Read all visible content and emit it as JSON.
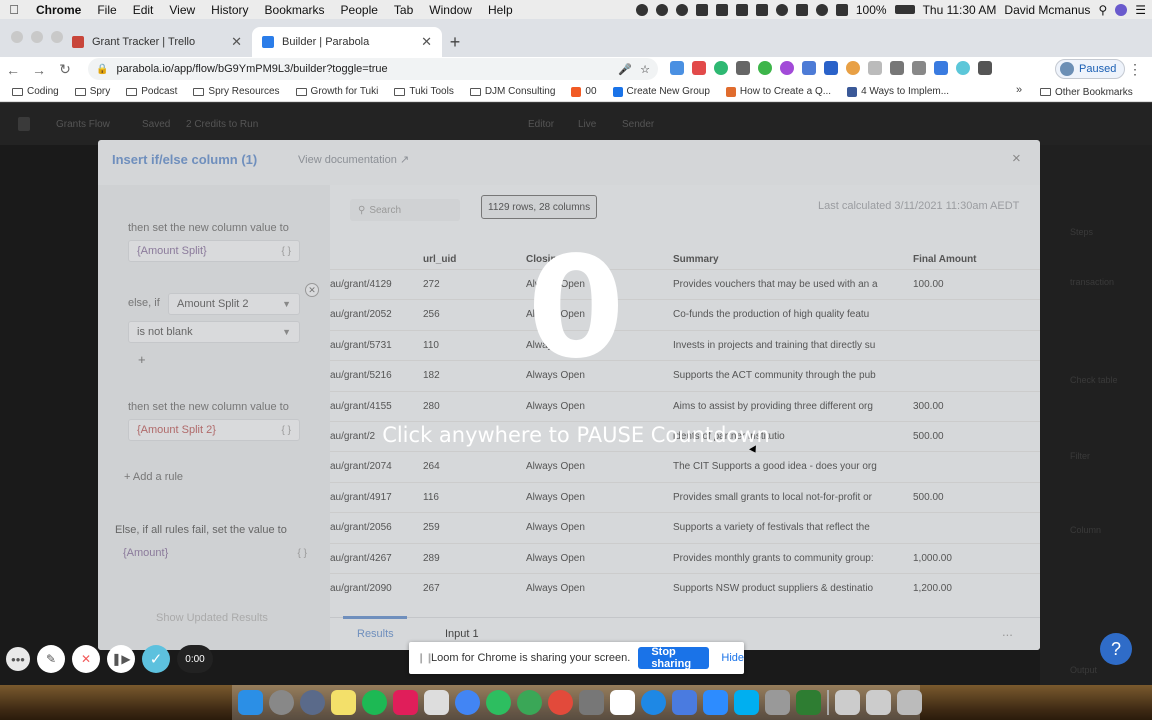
{
  "menubar": {
    "app": "Chrome",
    "items": [
      "File",
      "Edit",
      "View",
      "History",
      "Bookmarks",
      "People",
      "Tab",
      "Window",
      "Help"
    ],
    "battery": "100%",
    "clock": "Thu 11:30 AM",
    "user": "David Mcmanus"
  },
  "browser": {
    "tabs": [
      {
        "title": "Grant Tracker | Trello",
        "favicon_color": "#c8453a"
      },
      {
        "title": "Builder | Parabola",
        "favicon_color": "#2b7de9"
      }
    ],
    "new_tab": "+",
    "url": "parabola.io/app/flow/bG9YmPM9L3/builder?toggle=true",
    "profile": "Paused"
  },
  "bookmarks": [
    {
      "label": "Coding",
      "kind": "folder"
    },
    {
      "label": "Spry",
      "kind": "folder"
    },
    {
      "label": "Podcast",
      "kind": "folder"
    },
    {
      "label": "Spry Resources",
      "kind": "folder"
    },
    {
      "label": "Growth for Tuki",
      "kind": "folder"
    },
    {
      "label": "Tuki Tools",
      "kind": "folder"
    },
    {
      "label": "DJM Consulting",
      "kind": "folder"
    },
    {
      "label": "00",
      "kind": "link"
    },
    {
      "label": "Create New Group",
      "kind": "link"
    },
    {
      "label": "How to Create a Q...",
      "kind": "link"
    },
    {
      "label": "4 Ways to Implem...",
      "kind": "link"
    }
  ],
  "bookmarks_more": "»",
  "bookmarks_other": "Other Bookmarks",
  "appbar": {
    "flow_name": "Grants Flow",
    "saved": "Saved",
    "credits": "2 Credits to Run",
    "modes": [
      "Editor",
      "Live",
      "Sender"
    ]
  },
  "right_panel_labels": [
    "Steps",
    "transaction",
    "Check table",
    "Filter",
    "Column",
    "Output"
  ],
  "modal": {
    "title": "Insert if/else column (1)",
    "doc_link": "View documentation",
    "close": "×",
    "left": {
      "then_label_1": "then set the new column value to",
      "value_1": "{Amount Split}",
      "else_if": "else, if",
      "column_select": "Amount Split 2",
      "condition_select": "is not blank",
      "add_condition": "+",
      "then_label_2": "then set the new column value to",
      "value_2": "{Amount Split 2}",
      "add_rule": "Add a rule",
      "fallback_label": "Else, if all rules fail, set the value to",
      "fallback_value": "{Amount}",
      "show_updated": "Show Updated Results"
    },
    "search_placeholder": "Search",
    "row_count": "1129 rows, 28 columns",
    "last_calculated": "Last calculated 3/11/2021 11:30am AEDT",
    "columns": [
      "url_uid",
      "Closing",
      "Summary",
      "Final Amount"
    ],
    "rows": [
      {
        "url": "au/grant/4129",
        "uid": "272",
        "closing": "Always Open",
        "summary": "Provides vouchers that may be used with an a",
        "amount": "100.00"
      },
      {
        "url": "au/grant/2052",
        "uid": "256",
        "closing": "Always Open",
        "summary": "Co-funds the production of high quality featu",
        "amount": ""
      },
      {
        "url": "au/grant/5731",
        "uid": "110",
        "closing": "Always Open",
        "summary": "Invests in projects and training that directly su",
        "amount": ""
      },
      {
        "url": "au/grant/5216",
        "uid": "182",
        "closing": "Always Open",
        "summary": "Supports the ACT community through the pub",
        "amount": ""
      },
      {
        "url": "au/grant/4155",
        "uid": "280",
        "closing": "Always Open",
        "summary": "Aims to assist by providing three different org",
        "amount": "300.00"
      },
      {
        "url": "au/grant/2",
        "uid": "",
        "closing": "",
        "summary": "idents of partner institutio",
        "amount": "500.00"
      },
      {
        "url": "au/grant/2074",
        "uid": "264",
        "closing": "Always Open",
        "summary": "The CIT Supports a good idea - does your org",
        "amount": ""
      },
      {
        "url": "au/grant/4917",
        "uid": "116",
        "closing": "Always Open",
        "summary": "Provides small grants to local not-for-profit or",
        "amount": "500.00"
      },
      {
        "url": "au/grant/2056",
        "uid": "259",
        "closing": "Always Open",
        "summary": "Supports a variety of festivals that reflect the",
        "amount": ""
      },
      {
        "url": "au/grant/4267",
        "uid": "289",
        "closing": "Always Open",
        "summary": "Provides monthly grants to community group:",
        "amount": "1,000.00"
      },
      {
        "url": "au/grant/2090",
        "uid": "267",
        "closing": "Always Open",
        "summary": "Supports NSW product suppliers & destinatio",
        "amount": "1,200.00"
      }
    ],
    "bottom_tabs": [
      "Results",
      "Input 1"
    ],
    "more": "..."
  },
  "countdown": {
    "number": "0",
    "instruction": "Click anywhere to PAUSE Countdown"
  },
  "loom": {
    "share_message": "Loom for Chrome is sharing your screen.",
    "stop_label": "Stop sharing",
    "hide_label": "Hide",
    "timer": "0:00"
  },
  "help": "?",
  "colors": {
    "accent": "#2f6cc8",
    "modal_title": "#6f8fbd",
    "loom_check": "#5dc1de"
  }
}
